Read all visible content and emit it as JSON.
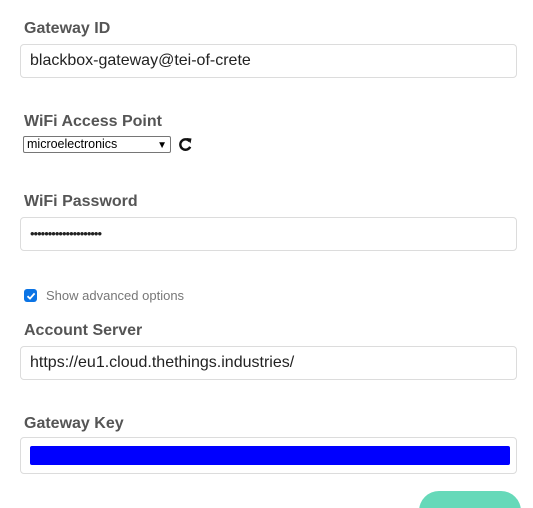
{
  "gateway_id": {
    "label": "Gateway ID",
    "value": "blackbox-gateway@tei-of-crete"
  },
  "wifi_access_point": {
    "label": "WiFi Access Point",
    "selected": "microelectronics",
    "refresh_icon": "refresh-icon"
  },
  "wifi_password": {
    "label": "WiFi Password",
    "value": "••••••••••••••••••••"
  },
  "advanced": {
    "label": "Show advanced options",
    "checked": true
  },
  "account_server": {
    "label": "Account Server",
    "value": "https://eu1.cloud.thethings.industries/"
  },
  "gateway_key": {
    "label": "Gateway Key",
    "value_hidden_color": "#0000ff"
  },
  "colors": {
    "checkbox": "#0b74e5",
    "submit_button": "#66d9b9"
  }
}
